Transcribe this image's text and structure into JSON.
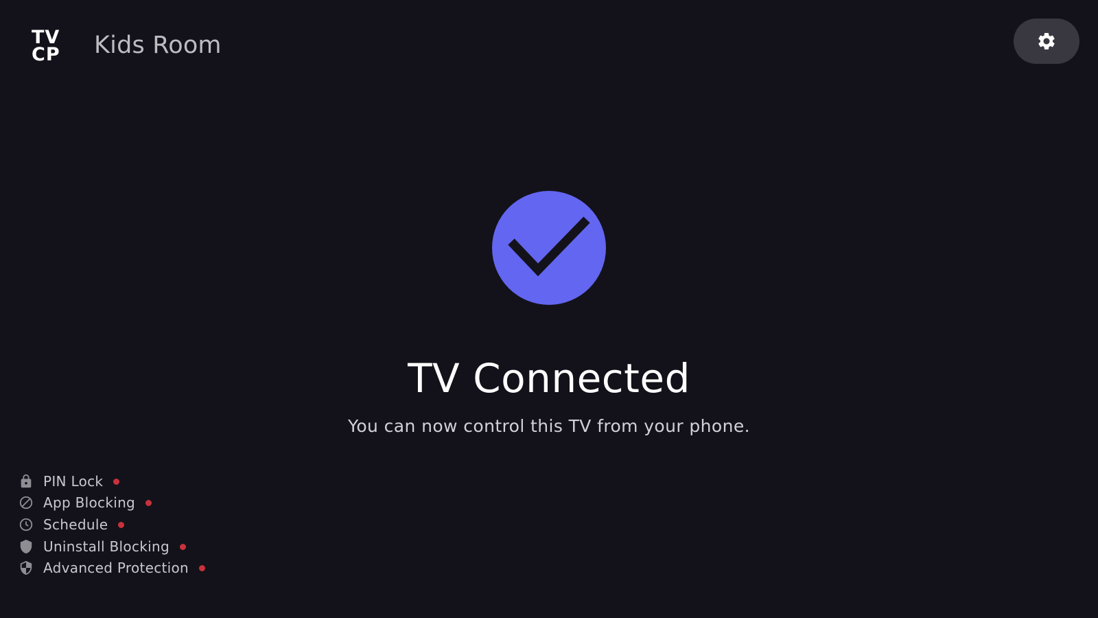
{
  "header": {
    "logo_line1": "TV",
    "logo_line2": "CP",
    "device_name": "Kids Room",
    "settings_icon": "gear-icon"
  },
  "status": {
    "icon": "checkmark-circle-icon",
    "title": "TV Connected",
    "subtitle": "You can now control this TV from your phone."
  },
  "features": [
    {
      "label": "PIN Lock",
      "icon": "lock-icon",
      "status": "inactive"
    },
    {
      "label": "App Blocking",
      "icon": "block-icon",
      "status": "inactive"
    },
    {
      "label": "Schedule",
      "icon": "clock-icon",
      "status": "inactive"
    },
    {
      "label": "Uninstall Blocking",
      "icon": "shield-icon",
      "status": "inactive"
    },
    {
      "label": "Advanced Protection",
      "icon": "half-shield-icon",
      "status": "inactive"
    }
  ],
  "colors": {
    "background": "#13121a",
    "accent": "#6366f1",
    "status_inactive": "#c8323a",
    "settings_button_bg": "#393840",
    "icon_gray": "#8e8d94"
  }
}
